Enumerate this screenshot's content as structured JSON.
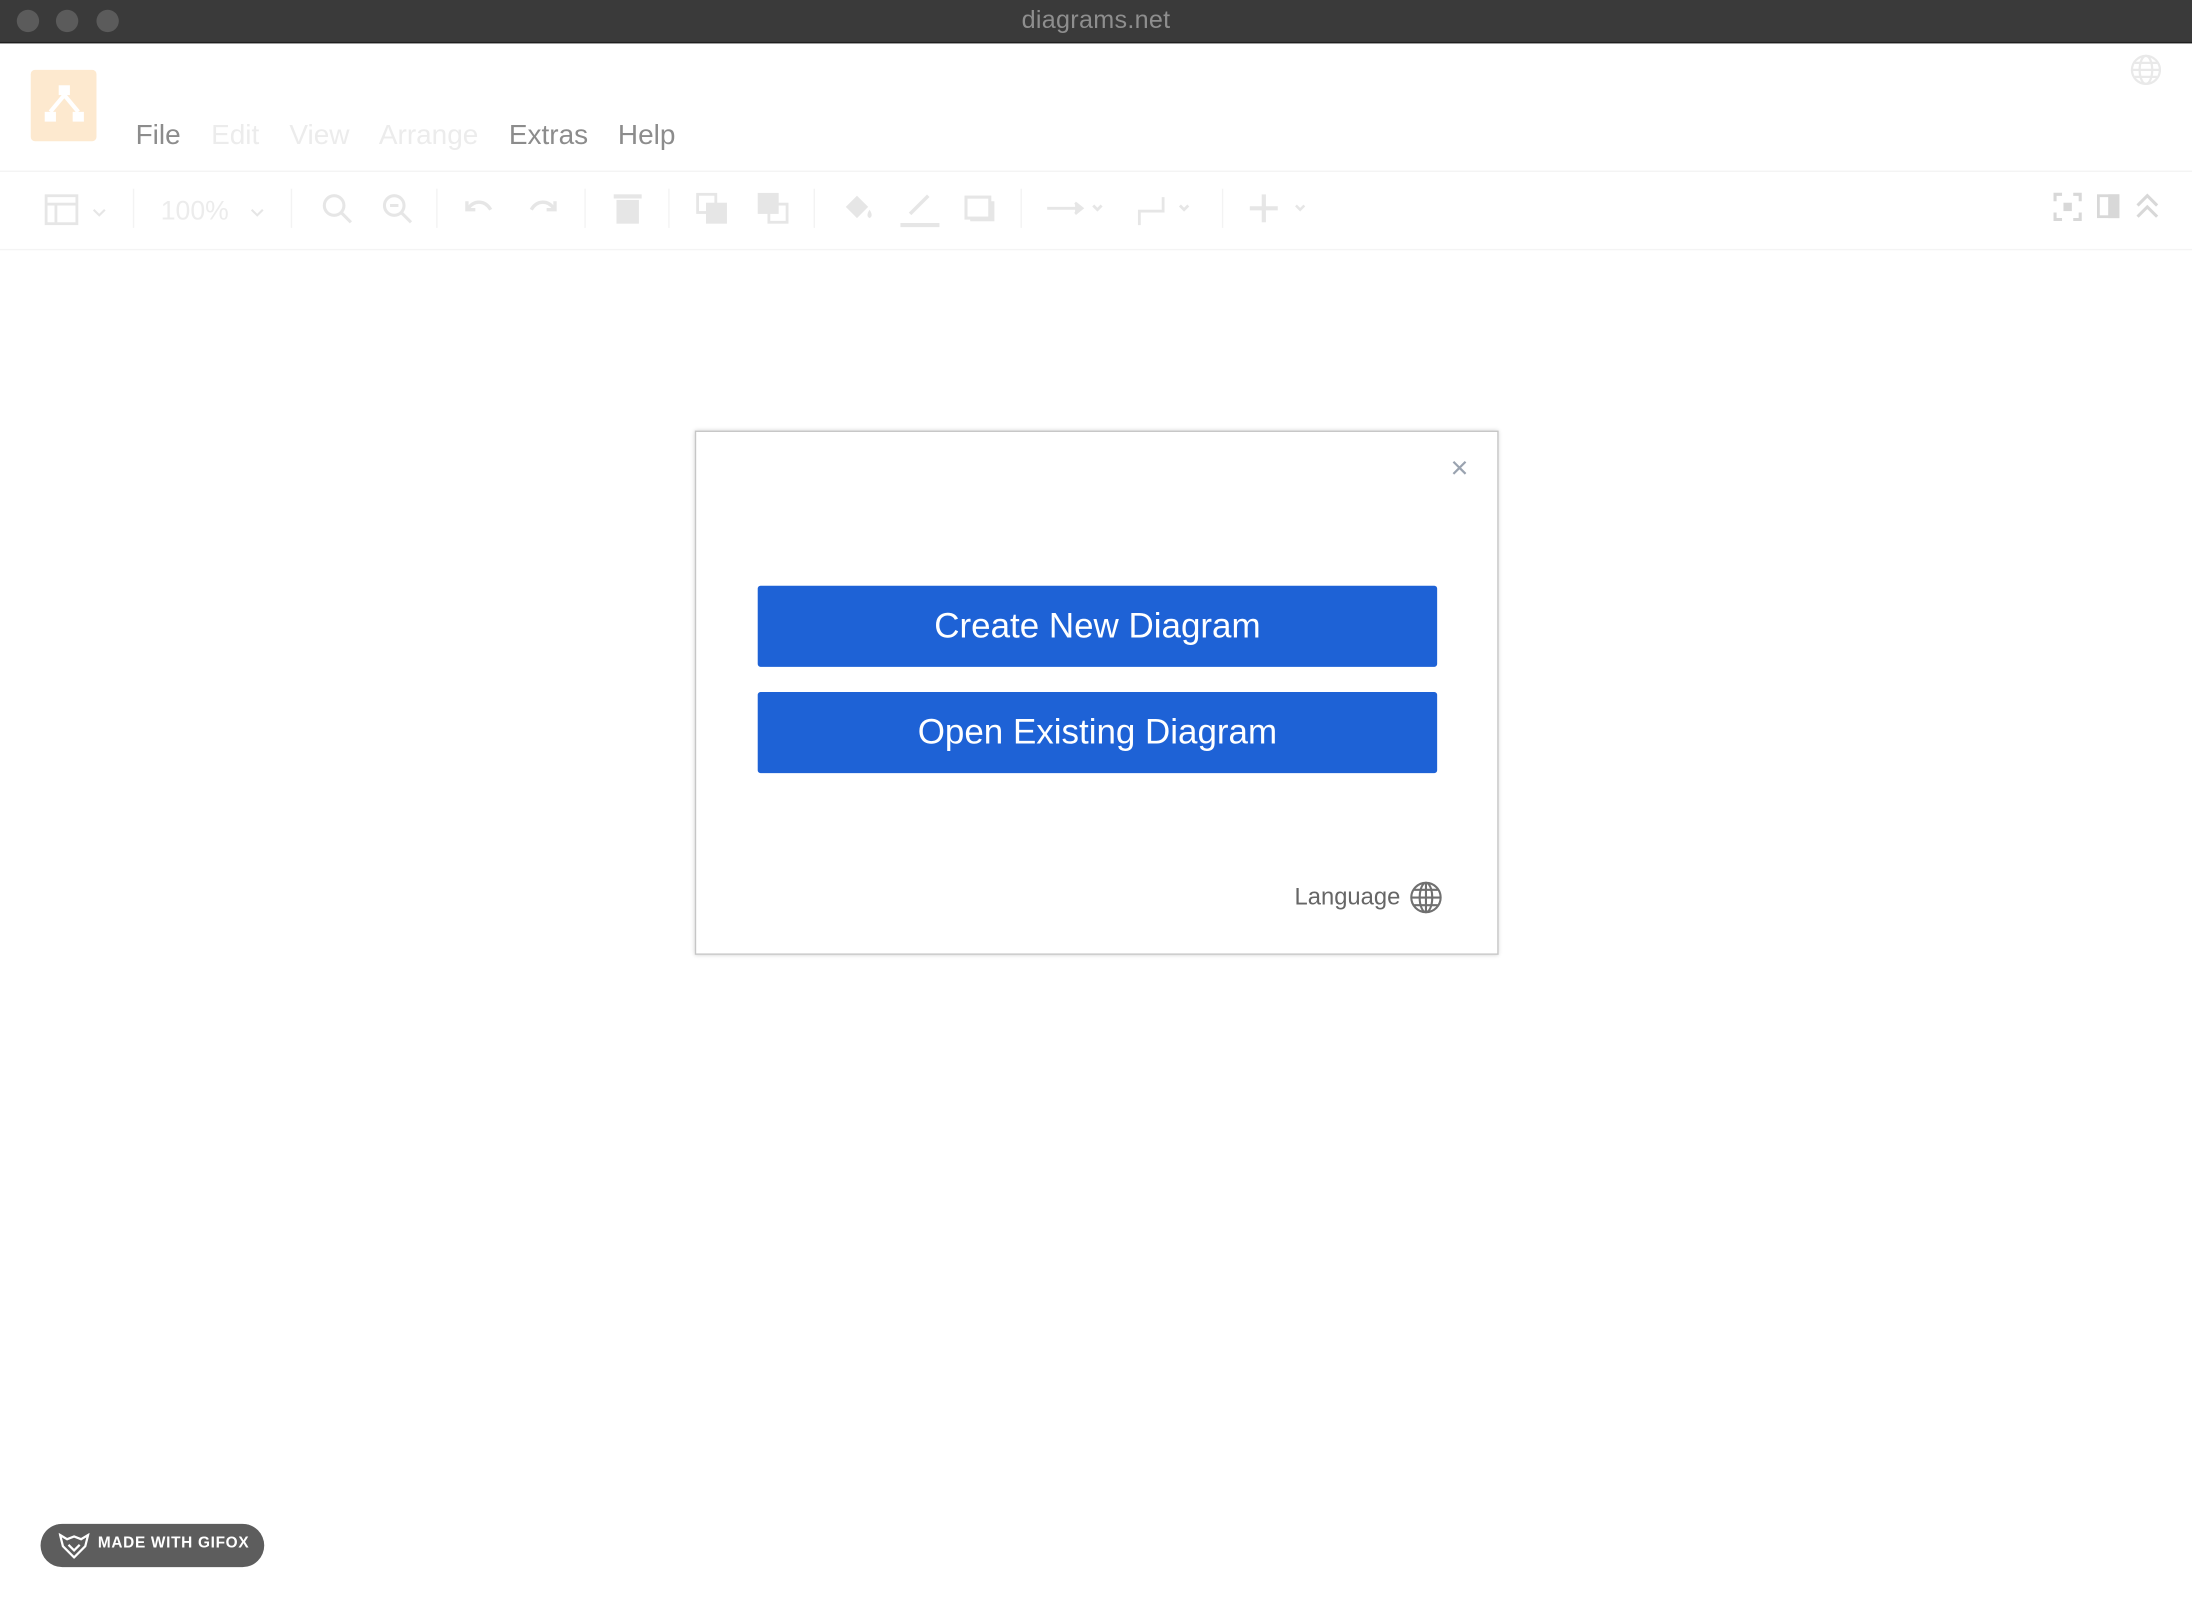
{
  "window": {
    "title": "diagrams.net"
  },
  "menubar": {
    "items": [
      {
        "label": "File",
        "enabled": true
      },
      {
        "label": "Edit",
        "enabled": false
      },
      {
        "label": "View",
        "enabled": false
      },
      {
        "label": "Arrange",
        "enabled": false
      },
      {
        "label": "Extras",
        "enabled": true
      },
      {
        "label": "Help",
        "enabled": true
      }
    ]
  },
  "toolbar": {
    "zoom_label": "100%"
  },
  "dialog": {
    "close_label": "×",
    "create_button": "Create New Diagram",
    "open_button": "Open Existing Diagram",
    "language_label": "Language"
  },
  "badge": {
    "label": "MADE WITH GIFOX"
  },
  "colors": {
    "primary_button": "#1e62d6",
    "logo_background": "#fde9cf",
    "titlebar": "#3a3a3a"
  },
  "icons": [
    "app-logo-icon",
    "globe-icon",
    "format-panel-icon",
    "zoom-in-icon",
    "zoom-out-icon",
    "undo-icon",
    "redo-icon",
    "delete-icon",
    "to-front-icon",
    "to-back-icon",
    "fill-color-icon",
    "line-color-icon",
    "shadow-icon",
    "connection-icon",
    "waypoints-icon",
    "insert-icon",
    "fullscreen-icon",
    "format-toggle-icon",
    "collapse-icon",
    "close-icon",
    "gifox-logo-icon"
  ]
}
